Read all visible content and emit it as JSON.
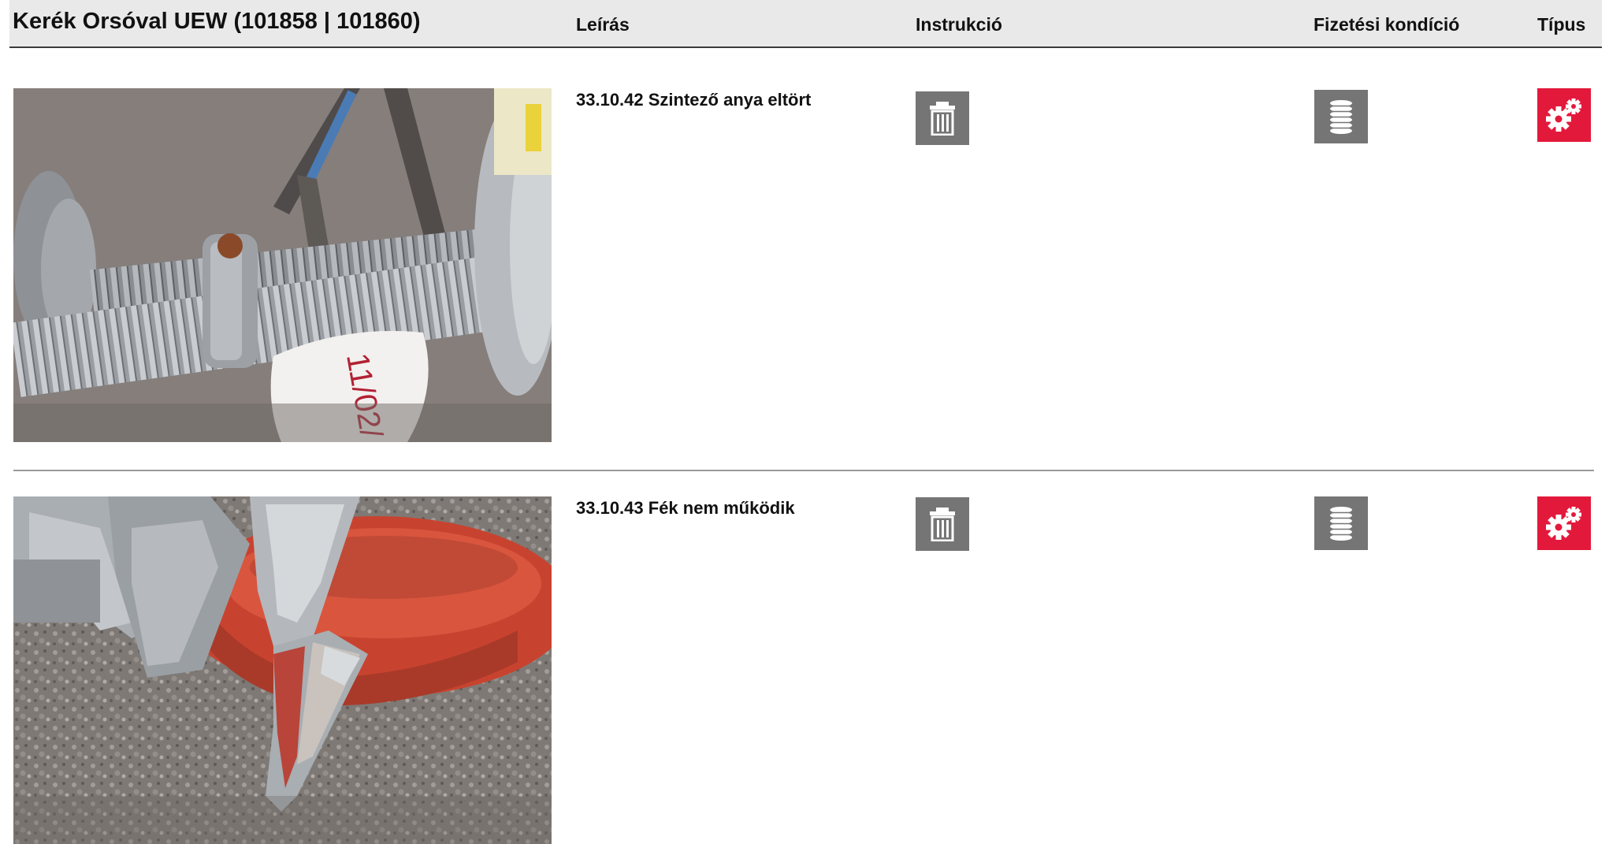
{
  "header": {
    "title": "Kerék Orsóval UEW (101858 | 101860)",
    "col_description": "Leírás",
    "col_instruction": "Instrukció",
    "col_payment": "Fizetési kondíció",
    "col_type": "Típus"
  },
  "items": [
    {
      "description": "33.10.42 Szintező anya eltört",
      "instruction_icon": "trash-icon",
      "payment_icon": "coin-stack-icon",
      "type_icon": "gears-icon",
      "type_color": "#e3193b"
    },
    {
      "description": "33.10.43 Fék nem működik",
      "instruction_icon": "trash-icon",
      "payment_icon": "coin-stack-icon",
      "type_icon": "gears-icon",
      "type_color": "#e3193b"
    }
  ],
  "colors": {
    "header_bg": "#e9e9e9",
    "icon_grey": "#757575",
    "type_red": "#e3193b"
  }
}
